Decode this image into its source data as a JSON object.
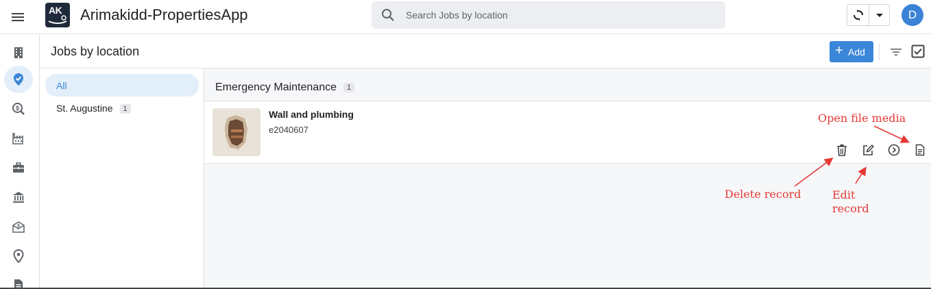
{
  "app": {
    "title": "Arimakidd-PropertiesApp",
    "logo_text": "AK",
    "avatar_initial": "D",
    "accent_color": "#3b86d8"
  },
  "search": {
    "placeholder": "Search Jobs by location"
  },
  "rail": {
    "items": [
      {
        "icon": "building-icon"
      },
      {
        "icon": "badge-check-icon",
        "active": true
      },
      {
        "icon": "search-dollar-icon"
      },
      {
        "icon": "factory-icon"
      },
      {
        "icon": "briefcase-icon"
      },
      {
        "icon": "bank-icon"
      },
      {
        "icon": "envelope-dollar-icon"
      },
      {
        "icon": "map-pin-icon"
      },
      {
        "icon": "document-icon"
      }
    ]
  },
  "page": {
    "title": "Jobs by location",
    "add_label": "Add",
    "add_plus": "+"
  },
  "locations": [
    {
      "label": "All",
      "count": ""
    },
    {
      "label": "St. Augustine",
      "count": "1"
    }
  ],
  "group": {
    "title": "Emergency Maintenance",
    "count": "1"
  },
  "record": {
    "title": "Wall and plumbing",
    "subtitle": "e2040607"
  },
  "annotations": {
    "open_file_media": "Open file media",
    "delete_record": "Delete record",
    "edit_record_line1": "Edit",
    "edit_record_line2": "record"
  }
}
